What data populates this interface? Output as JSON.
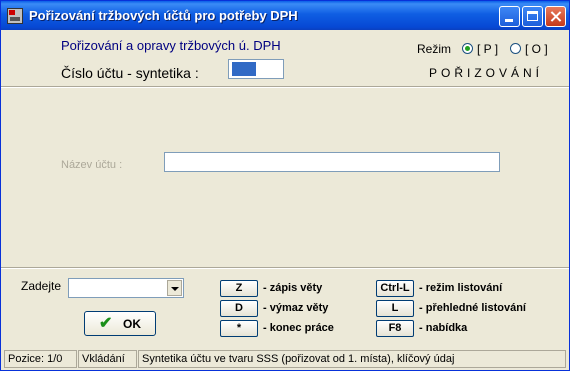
{
  "window": {
    "title": "Pořizování tržbových účtů pro potřeby DPH"
  },
  "form": {
    "heading": "Pořizování a opravy tržbových ú. DPH",
    "account_label": "Číslo účtu - syntetika :",
    "mode_label": "Režim",
    "mode_p": "[ P ]",
    "mode_o": "[ O ]",
    "mode_selected": "P",
    "mode_state": "POŘIZOVÁNÍ",
    "name_label": "Název účtu :",
    "name_value": ""
  },
  "bottom": {
    "enter_label": "Zadejte",
    "combo_value": "",
    "ok_label": "OK"
  },
  "shortcuts": [
    {
      "key": "Z",
      "desc": "- zápis věty"
    },
    {
      "key": "D",
      "desc": "- výmaz věty"
    },
    {
      "key": "*",
      "desc": "- konec práce"
    },
    {
      "key": "Ctrl-L",
      "desc": "- režim listování"
    },
    {
      "key": "L",
      "desc": "- přehledné listování"
    },
    {
      "key": "F8",
      "desc": "- nabídka"
    }
  ],
  "status": {
    "position": "Pozice: 1/0",
    "mode": "Vkládání",
    "hint": "Syntetika účtu ve tvaru SSS (pořizovat od 1. místa), klíčový údaj"
  }
}
